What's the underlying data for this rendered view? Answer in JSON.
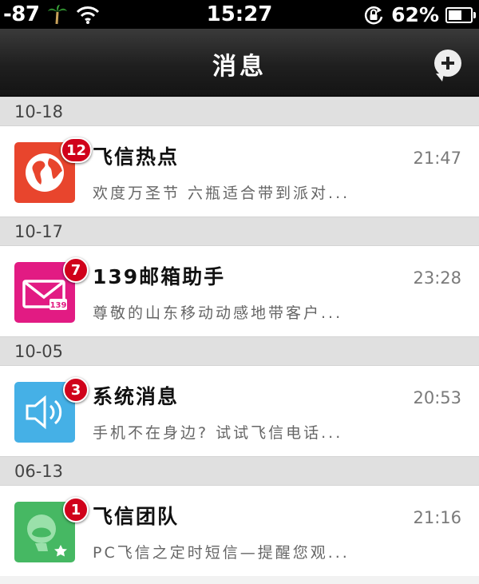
{
  "status_bar": {
    "signal": "-87",
    "time": "15:27",
    "battery_text": "62%",
    "battery_level": 0.62
  },
  "nav": {
    "title": "消息"
  },
  "conversations": [
    {
      "date": "10-18",
      "name": "飞信热点",
      "time": "21:47",
      "preview": "欢度万圣节 六瓶适合带到派对...",
      "badge": "12",
      "icon": "globe-icon",
      "color": "#e8452d"
    },
    {
      "date": "10-17",
      "name": "139邮箱助手",
      "time": "23:28",
      "preview": "尊敬的山东移动动感地带客户...",
      "badge": "7",
      "icon": "mail-139-icon",
      "color": "#e21b83"
    },
    {
      "date": "10-05",
      "name": "系统消息",
      "time": "20:53",
      "preview": "手机不在身边? 试试飞信电话...",
      "badge": "3",
      "icon": "speaker-icon",
      "color": "#45b0e6"
    },
    {
      "date": "06-13",
      "name": "飞信团队",
      "time": "21:16",
      "preview": "PC飞信之定时短信—提醒您观...",
      "badge": "1",
      "icon": "fetion-team-icon",
      "color": "#46b863"
    }
  ]
}
